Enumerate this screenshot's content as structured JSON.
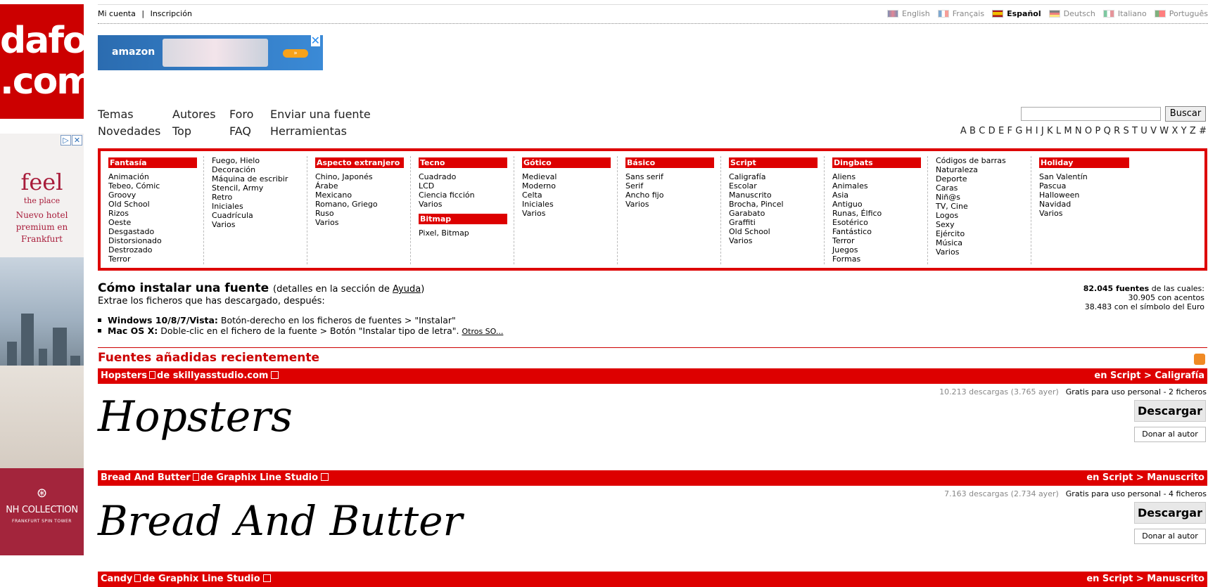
{
  "logo": {
    "line1": "dafont",
    "line2": ".com"
  },
  "left_ad": {
    "feel": "feel",
    "place": "the place",
    "hotel": "Nuevo hotel premium en Frankfurt",
    "brand": "NH COLLECTION",
    "brand_sub": "FRANKFURT SPIN TOWER"
  },
  "topbar": {
    "account": "Mi cuenta",
    "separator": "|",
    "signup": "Inscripción",
    "languages": [
      {
        "label": "English",
        "active": false
      },
      {
        "label": "Français",
        "active": false
      },
      {
        "label": "Español",
        "active": true
      },
      {
        "label": "Deutsch",
        "active": false
      },
      {
        "label": "Italiano",
        "active": false
      },
      {
        "label": "Português",
        "active": false
      }
    ]
  },
  "amazon_ad": {
    "name": "amazon"
  },
  "nav": {
    "row1": [
      "Temas",
      "Autores",
      "Foro",
      "Enviar una fuente"
    ],
    "row2": [
      "Novedades",
      "Top",
      "FAQ",
      "Herramientas"
    ]
  },
  "search": {
    "value": "",
    "button": "Buscar"
  },
  "alphabet": [
    "A",
    "B",
    "C",
    "D",
    "E",
    "F",
    "G",
    "H",
    "I",
    "J",
    "K",
    "L",
    "M",
    "N",
    "O",
    "P",
    "Q",
    "R",
    "S",
    "T",
    "U",
    "V",
    "W",
    "X",
    "Y",
    "Z",
    "#"
  ],
  "categories": [
    {
      "head": "Fantasía",
      "items": [
        "Animación",
        "Tebeo, Cómic",
        "Groovy",
        "Old School",
        "Rizos",
        "Oeste",
        "Desgastado",
        "Distorsionado",
        "Destrozado",
        "Terror"
      ]
    },
    {
      "head": "",
      "items": [
        "Fuego, Hielo",
        "Decoración",
        "Máquina de escribir",
        "Stencil, Army",
        "Retro",
        "Iniciales",
        "Cuadrícula",
        "Varios"
      ]
    },
    {
      "head": "Aspecto extranjero",
      "items": [
        "Chino, Japonés",
        "Árabe",
        "Mexicano",
        "Romano, Griego",
        "Ruso",
        "Varios"
      ]
    },
    {
      "head": "Tecno",
      "items": [
        "Cuadrado",
        "LCD",
        "Ciencia ficción",
        "Varios"
      ],
      "head2": "Bitmap",
      "items2": [
        "Pixel, Bitmap"
      ]
    },
    {
      "head": "Gótico",
      "items": [
        "Medieval",
        "Moderno",
        "Celta",
        "Iniciales",
        "Varios"
      ]
    },
    {
      "head": "Básico",
      "items": [
        "Sans serif",
        "Serif",
        "Ancho fijo",
        "Varios"
      ]
    },
    {
      "head": "Script",
      "items": [
        "Caligrafía",
        "Escolar",
        "Manuscrito",
        "Brocha, Pincel",
        "Garabato",
        "Graffiti",
        "Old School",
        "Varios"
      ]
    },
    {
      "head": "Dingbats",
      "items": [
        "Aliens",
        "Animales",
        "Asia",
        "Antiguo",
        "Runas, Élfico",
        "Esotérico",
        "Fantástico",
        "Terror",
        "Juegos",
        "Formas"
      ]
    },
    {
      "head": "",
      "items": [
        "Códigos de barras",
        "Naturaleza",
        "Deporte",
        "Caras",
        "Niñ@s",
        "TV, Cine",
        "Logos",
        "Sexy",
        "Ejército",
        "Música",
        "Varios"
      ]
    },
    {
      "head": "Holiday",
      "items": [
        "San Valentín",
        "Pascua",
        "Halloween",
        "Navidad",
        "Varios"
      ]
    }
  ],
  "install": {
    "title": "Cómo instalar una fuente",
    "details_pre": "(detalles en la sección de ",
    "details_link": "Ayuda",
    "details_post": ")",
    "subtitle": "Extrae los ficheros que has descargado, después:",
    "win_label": "Windows 10/8/7/Vista:",
    "win_text": "Botón-derecho en los ficheros de fuentes > \"Instalar\"",
    "mac_label": "Mac OS X:",
    "mac_text": "Doble-clic en el fichero de la fuente > Botón \"Instalar tipo de letra\".",
    "other": "Otros SO..."
  },
  "stats": {
    "count": "82.045 fuentes",
    "count_suffix": "de las cuales:",
    "accents": "30.905 con acentos",
    "euro": "38.483 con el símbolo del Euro"
  },
  "recent": {
    "title": "Fuentes añadidas recientemente"
  },
  "fonts": [
    {
      "name": "Hopsters",
      "by": "de skillyasstudio.com",
      "category": "en Script > Caligrafía",
      "downloads": "10.213 descargas (3.765 ayer)",
      "license": "Gratis para uso personal - 2 ficheros",
      "download_btn": "Descargar",
      "donate_btn": "Donar al autor",
      "preview": "Hopsters"
    },
    {
      "name": "Bread And Butter",
      "by": "de Graphix Line Studio",
      "category": "en Script > Manuscrito",
      "downloads": "7.163 descargas (2.734 ayer)",
      "license": "Gratis para uso personal - 4 ficheros",
      "download_btn": "Descargar",
      "donate_btn": "Donar al autor",
      "preview": "Bread And Butter"
    },
    {
      "name": "Candy",
      "by": "de Graphix Line Studio",
      "category": "en Script > Manuscrito"
    }
  ],
  "colors": {
    "brand_red": "#dd0000",
    "link": "#000000"
  }
}
